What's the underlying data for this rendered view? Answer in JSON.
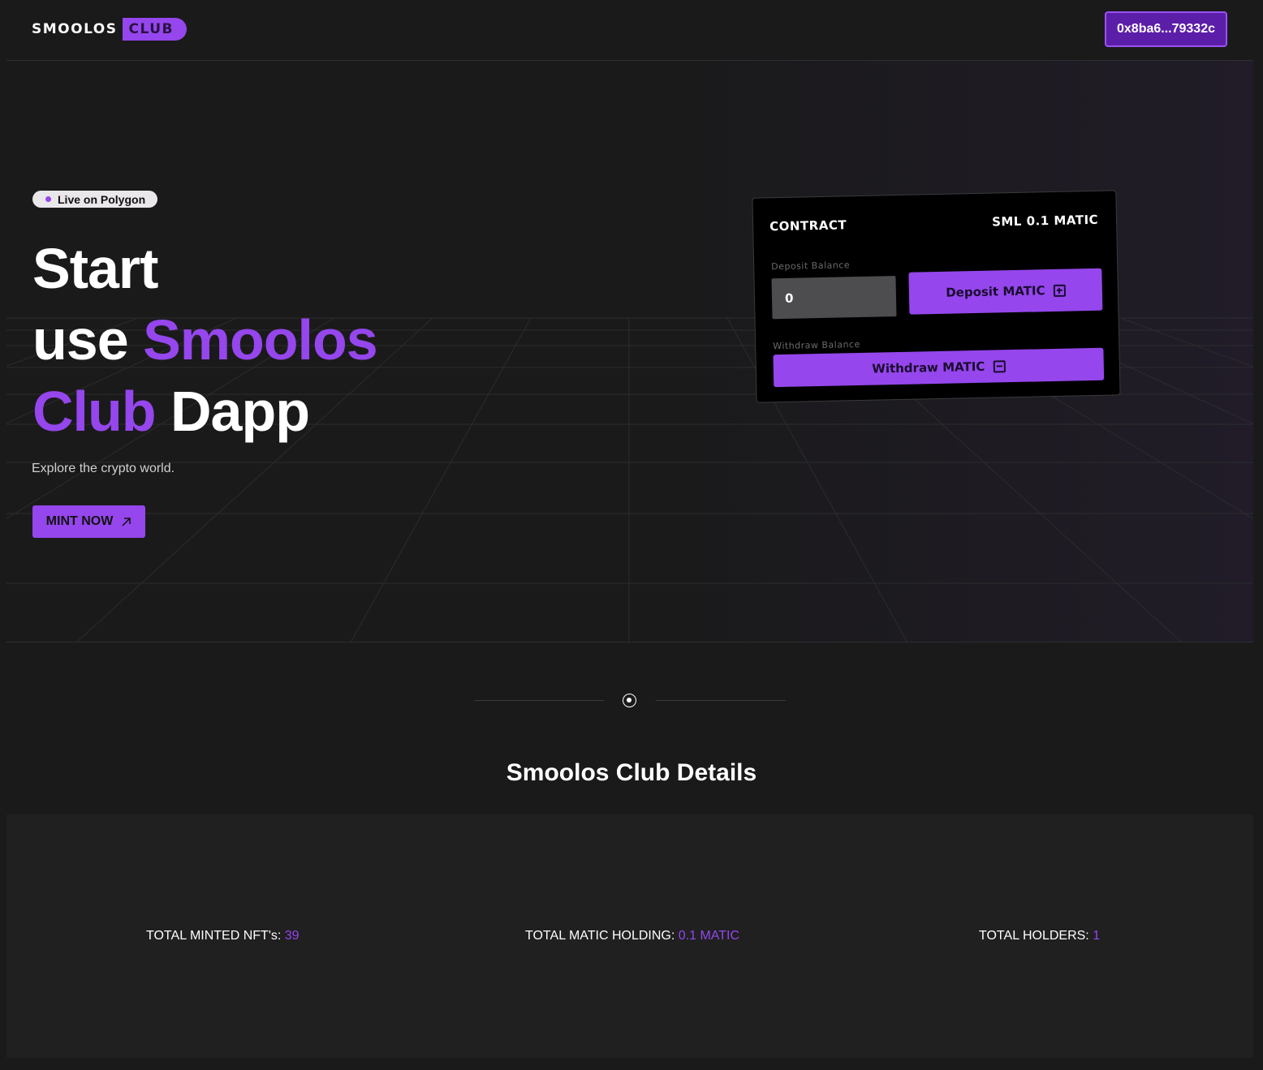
{
  "header": {
    "logo_main": "SMOOLOS",
    "logo_club": "CLUB",
    "wallet_address": "0x8ba6...79332c"
  },
  "hero": {
    "badge": "Live on Polygon",
    "headline_line1": "Start",
    "headline_use": "use ",
    "headline_smoolos": "Smoolos",
    "headline_club": "Club",
    "headline_dapp": " Dapp",
    "subtitle": "Explore the crypto world.",
    "mint_label": "MINT NOW",
    "mint_icon": "arrow-up-right-icon"
  },
  "contract": {
    "title": "CONTRACT",
    "price": "SML 0.1 MATIC",
    "deposit_label": "Deposit Balance",
    "deposit_value": "0",
    "deposit_button": "Deposit MATIC",
    "withdraw_label": "Withdraw Balance",
    "withdraw_button": "Withdraw MATIC"
  },
  "details": {
    "title": "Smoolos Club Details",
    "stats": [
      {
        "label": "TOTAL MINTED NFT's: ",
        "value": "39"
      },
      {
        "label": "TOTAL MATIC HOLDING: ",
        "value": "0.1 MATIC"
      },
      {
        "label": "TOTAL HOLDERS: ",
        "value": "1"
      }
    ]
  },
  "colors": {
    "accent": "#9546ec",
    "background": "#1a1a1b",
    "panel": "#202021"
  }
}
